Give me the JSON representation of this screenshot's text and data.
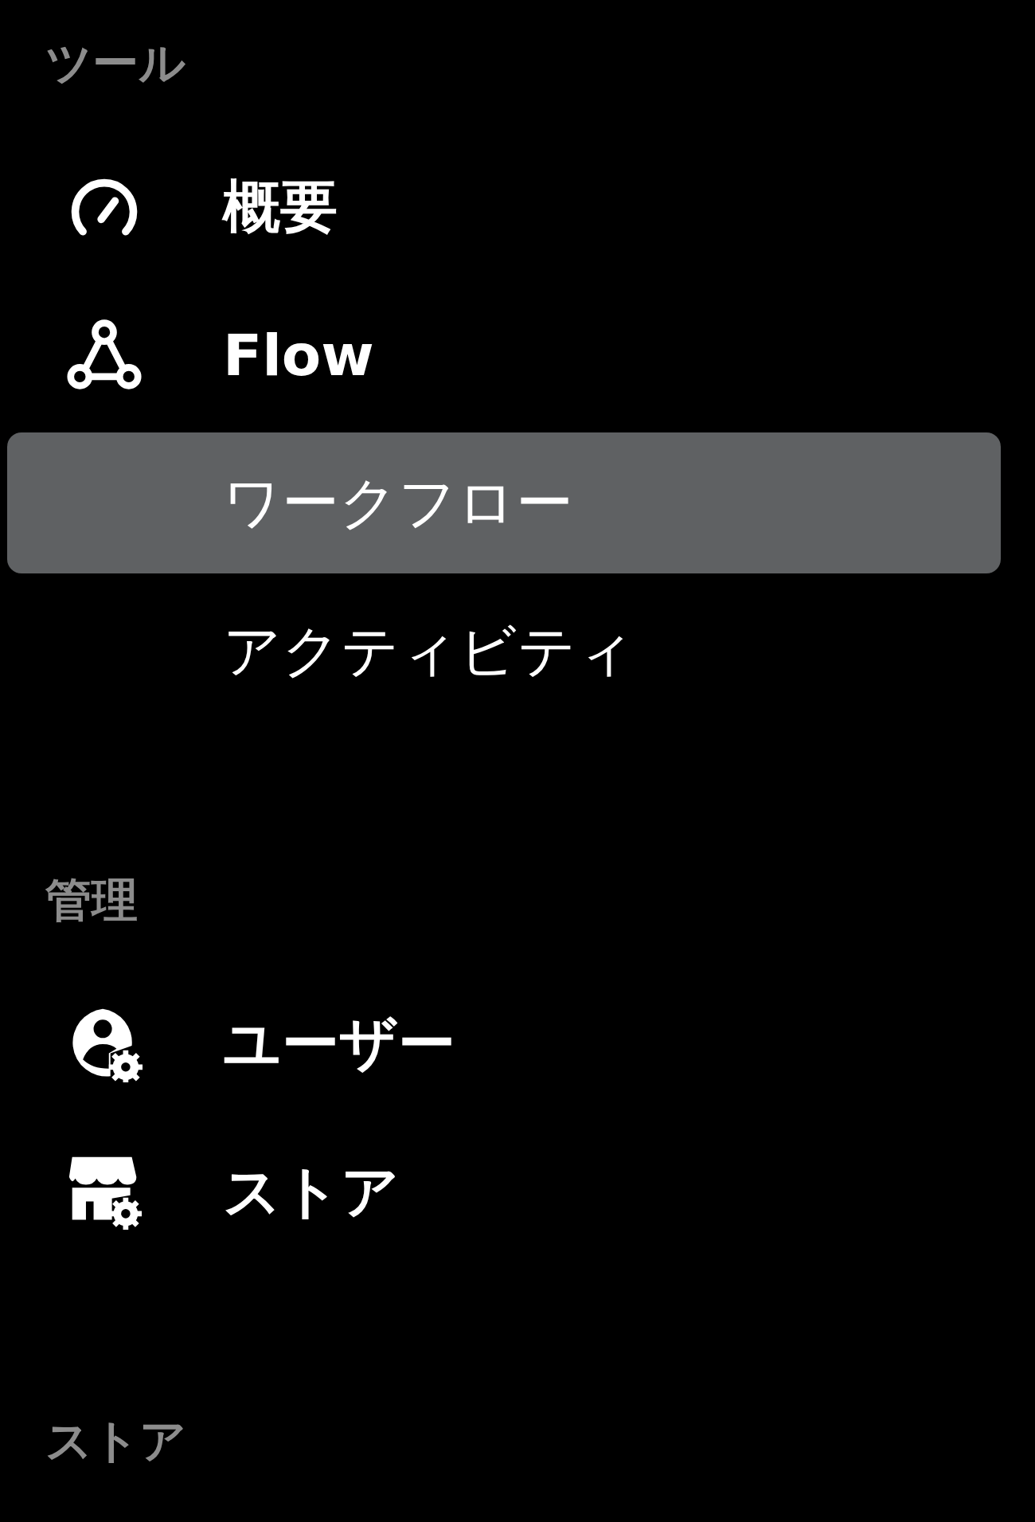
{
  "sections": [
    {
      "title": "ツール",
      "items": [
        {
          "label": "概要",
          "selected": false
        },
        {
          "label": "Flow",
          "selected": false,
          "children": [
            {
              "label": "ワークフロー",
              "selected": true
            },
            {
              "label": "アクティビティ",
              "selected": false
            }
          ]
        }
      ]
    },
    {
      "title": "管理",
      "items": [
        {
          "label": "ユーザー",
          "selected": false
        },
        {
          "label": "ストア",
          "selected": false
        }
      ]
    },
    {
      "title": "ストア"
    }
  ]
}
